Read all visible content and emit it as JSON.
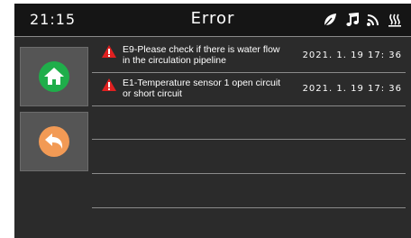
{
  "header": {
    "time": "21:15",
    "title": "Error",
    "status_icons": [
      "leaf-icon",
      "music-note-icon",
      "wifi-signal-icon",
      "heating-icon"
    ]
  },
  "sidebar": {
    "home_icon": "home-icon",
    "back_icon": "back-arrow-icon"
  },
  "errors": [
    {
      "line1": "E9-Please check if there is water flow",
      "line2": "in the circulation pipeline",
      "timestamp": "2021. 1. 19 17: 36"
    },
    {
      "line1": "E1-Temperature sensor 1 open circuit",
      "line2": "or  short circuit",
      "timestamp": "2021. 1. 19 17: 36"
    }
  ],
  "colors": {
    "background": "#2b2b2b",
    "topbar": "#151515",
    "home_button": "#1fae4a",
    "back_button": "#f29a55",
    "warning": "#e02020"
  }
}
